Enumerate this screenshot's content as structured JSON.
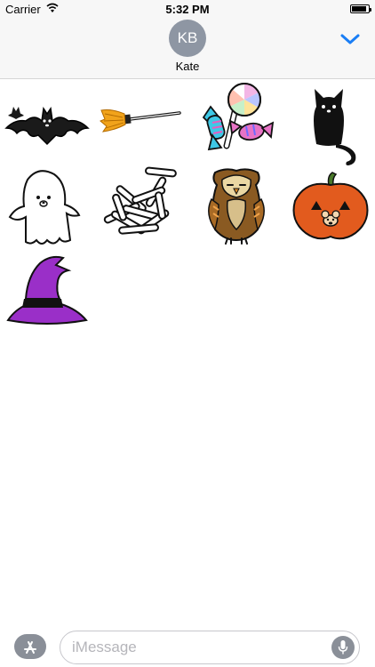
{
  "status_bar": {
    "carrier": "Carrier",
    "time": "5:32 PM",
    "battery_level": 0.9
  },
  "header": {
    "avatar_initials": "KB",
    "contact_name": "Kate"
  },
  "stickers": [
    {
      "name": "bat",
      "icon": "bat-icon"
    },
    {
      "name": "broom",
      "icon": "broom-icon"
    },
    {
      "name": "candy",
      "icon": "candy-icon"
    },
    {
      "name": "black-cat",
      "icon": "black-cat-icon"
    },
    {
      "name": "ghost",
      "icon": "ghost-icon"
    },
    {
      "name": "bones",
      "icon": "bones-icon"
    },
    {
      "name": "owl",
      "icon": "owl-icon"
    },
    {
      "name": "pumpkin",
      "icon": "pumpkin-icon"
    },
    {
      "name": "witch-hat",
      "icon": "witch-hat-icon"
    }
  ],
  "compose": {
    "placeholder": "iMessage",
    "value": ""
  },
  "colors": {
    "accent": "#1a7ef5",
    "witch_hat": "#9a2fc8",
    "pumpkin": "#e25b1e",
    "owl": "#8a5a22",
    "broom": "#f1a31b",
    "candy_blue": "#3ec8e6",
    "candy_pink": "#e873c6"
  }
}
